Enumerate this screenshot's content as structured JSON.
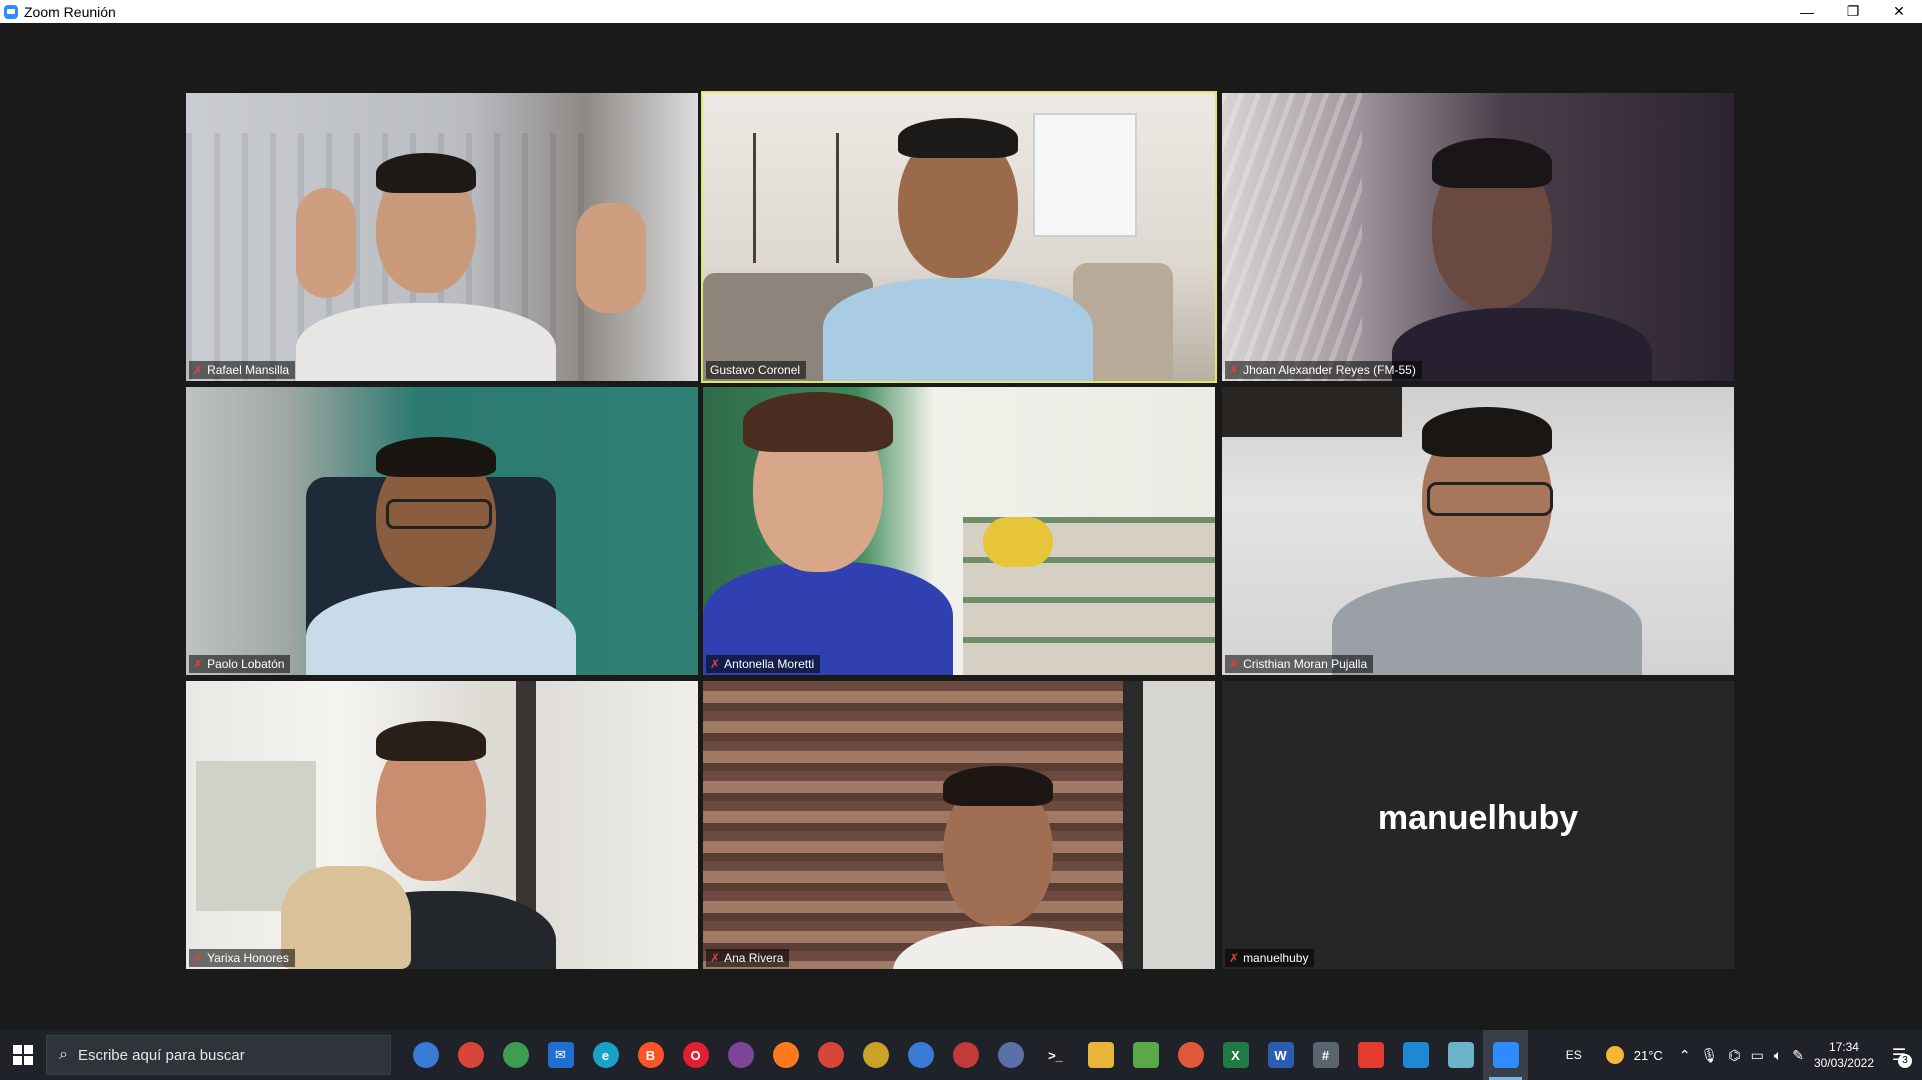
{
  "window": {
    "title": "Zoom Reunión",
    "minimize_icon": "minimize-icon",
    "restore_icon": "restore-icon",
    "close_icon": "close-icon"
  },
  "participants": [
    {
      "name": "Rafael Mansilla",
      "muted": true,
      "video": true,
      "active_speaker": false
    },
    {
      "name": "Gustavo Coronel",
      "muted": false,
      "video": true,
      "active_speaker": true
    },
    {
      "name": "Jhoan Alexander Reyes (FM-55)",
      "muted": true,
      "video": true,
      "active_speaker": false
    },
    {
      "name": "Paolo Lobatón",
      "muted": true,
      "video": true,
      "active_speaker": false
    },
    {
      "name": "Antonella Moretti",
      "muted": true,
      "video": true,
      "active_speaker": false
    },
    {
      "name": "Cristhian Moran Pujalla",
      "muted": true,
      "video": true,
      "active_speaker": false
    },
    {
      "name": "Yarixa Honores",
      "muted": true,
      "video": true,
      "active_speaker": false
    },
    {
      "name": "Ana Rivera",
      "muted": true,
      "video": true,
      "active_speaker": false
    },
    {
      "name": "manuelhuby",
      "muted": true,
      "video": false,
      "active_speaker": false,
      "display_name": "manuelhuby"
    }
  ],
  "colors": {
    "active_speaker_border": "#dfe86b",
    "muted_icon": "#e0413a",
    "stage_background": "#1a1a1a",
    "taskbar_background": "#1f2329"
  },
  "taskbar": {
    "search_placeholder": "Escribe aquí para buscar",
    "apps": [
      {
        "name": "cortana-icon",
        "color": "#3a7bd5",
        "glyph": ""
      },
      {
        "name": "chrome-icon",
        "color": "#d9453a",
        "glyph": ""
      },
      {
        "name": "chrome-profile-icon",
        "color": "#3e9d4f",
        "glyph": ""
      },
      {
        "name": "mail-icon",
        "color": "#1f6fd1",
        "glyph": "✉"
      },
      {
        "name": "edge-icon",
        "color": "#1aa0c9",
        "glyph": "e"
      },
      {
        "name": "brave-icon",
        "color": "#fb542b",
        "glyph": "B"
      },
      {
        "name": "opera-icon",
        "color": "#e0202f",
        "glyph": "O"
      },
      {
        "name": "tor-icon",
        "color": "#7d4698",
        "glyph": ""
      },
      {
        "name": "firefox-icon",
        "color": "#ff7a1f",
        "glyph": ""
      },
      {
        "name": "chrome-icon-2",
        "color": "#d9453a",
        "glyph": ""
      },
      {
        "name": "chrome-icon-3",
        "color": "#c9a227",
        "glyph": ""
      },
      {
        "name": "chrome-icon-4",
        "color": "#3a7bd5",
        "glyph": ""
      },
      {
        "name": "chrome-icon-5",
        "color": "#c23a3a",
        "glyph": ""
      },
      {
        "name": "eclipse-icon",
        "color": "#5b6fa8",
        "glyph": ""
      },
      {
        "name": "terminal-icon",
        "color": "#222222",
        "glyph": ">_"
      },
      {
        "name": "file-explorer-icon",
        "color": "#e8b53a",
        "glyph": ""
      },
      {
        "name": "notepad-icon",
        "color": "#5aa84a",
        "glyph": ""
      },
      {
        "name": "git-icon",
        "color": "#e05a3a",
        "glyph": ""
      },
      {
        "name": "excel-icon",
        "color": "#1e7b45",
        "glyph": "X"
      },
      {
        "name": "word-icon",
        "color": "#2b5cb0",
        "glyph": "W"
      },
      {
        "name": "calculator-icon",
        "color": "#5a6470",
        "glyph": "#"
      },
      {
        "name": "anydesk-icon",
        "color": "#e33b2e",
        "glyph": ""
      },
      {
        "name": "vscode-icon",
        "color": "#1e88d4",
        "glyph": ""
      },
      {
        "name": "notes-icon",
        "color": "#6bb3c9",
        "glyph": ""
      },
      {
        "name": "zoom-icon",
        "color": "#2d8cff",
        "glyph": "",
        "active": true
      }
    ],
    "language": "ES",
    "weather": "21°C",
    "time": "17:34",
    "date": "30/03/2022",
    "notification_count": "3"
  }
}
